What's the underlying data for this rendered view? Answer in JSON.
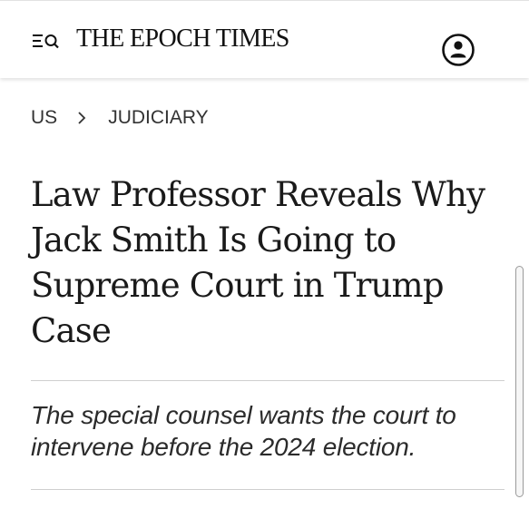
{
  "header": {
    "masthead": "THE EPOCH TIMES",
    "menu_search_icon": "menu-search-icon",
    "account_icon": "account-icon"
  },
  "breadcrumb": {
    "items": [
      "US",
      "JUDICIARY"
    ],
    "separator_icon": "chevron-right-icon"
  },
  "article": {
    "headline": "Law Professor Reveals Why Jack Smith Is Going to Supreme Court in Trump Case",
    "subheadline": "The special counsel wants the court to intervene before the 2024 election."
  },
  "colors": {
    "text": "#1a1a1a",
    "rule": "#cfcfcf",
    "background": "#ffffff"
  }
}
